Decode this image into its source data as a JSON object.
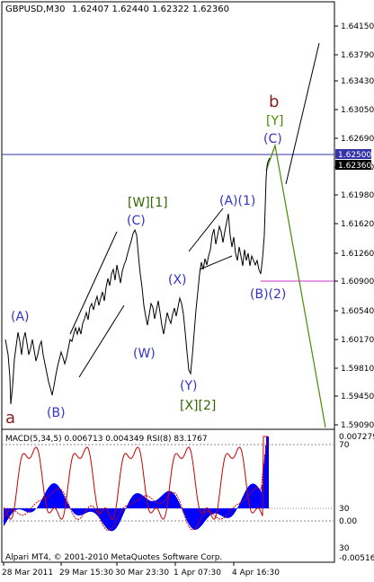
{
  "header": {
    "symbol": "GBPUSD,M30",
    "ohlc": "1.62407 1.62440 1.62322 1.62360"
  },
  "indicator_header": "MACD(5,34,5) 0.006713 0.004349 RSI(8) 83.1767",
  "footer_text": "Alpari MT4, © 2001-2010 MetaQuotes Software Corp.",
  "price_axis": {
    "labels": [
      "1.64150",
      "1.63790",
      "1.63430",
      "1.63050",
      "1.62690",
      "1.62330",
      "1.61980",
      "1.61620",
      "1.61260",
      "1.60900",
      "1.60540",
      "1.60170",
      "1.59810",
      "1.59450",
      "1.59090"
    ],
    "level_value": "1.62500",
    "current_value": "1.62360"
  },
  "indicator_axis": {
    "labels": [
      "0.007279",
      "70",
      "30",
      "0.00",
      "30",
      "-0.00516"
    ]
  },
  "time_axis": {
    "labels": [
      "28 Mar 2011",
      "29 Mar 15:30",
      "30 Mar 23:30",
      "1 Apr 07:30",
      "4 Apr 16:30"
    ]
  },
  "wave_labels": [
    {
      "text": "(A)",
      "color": "#3333cc"
    },
    {
      "text": "(B)",
      "color": "#3333cc"
    },
    {
      "text": "[W][1]",
      "color": "#336600"
    },
    {
      "text": "(C)",
      "color": "#3333cc"
    },
    {
      "text": "(W)",
      "color": "#3333cc"
    },
    {
      "text": "(X)",
      "color": "#3333cc"
    },
    {
      "text": "(Y)",
      "color": "#3333cc"
    },
    {
      "text": "[X][2]",
      "color": "#336600"
    },
    {
      "text": "(A)(1)",
      "color": "#3333cc"
    },
    {
      "text": "(B)(2)",
      "color": "#3333cc"
    },
    {
      "text": "b",
      "color": "#8b1a1a"
    },
    {
      "text": "[Y]",
      "color": "#4b8b00"
    },
    {
      "text": "(C)",
      "color": "#3333cc"
    },
    {
      "text": "a",
      "color": "#8b1a1a"
    }
  ],
  "colors": {
    "price_line": "#000000",
    "level_line": "#3333aa",
    "pink_line": "#cc33cc",
    "forecast_green": "#4b8b00",
    "macd_hist": "#0000ff",
    "rsi_line": "#cc0000",
    "signal_line": "#cc0000"
  }
}
